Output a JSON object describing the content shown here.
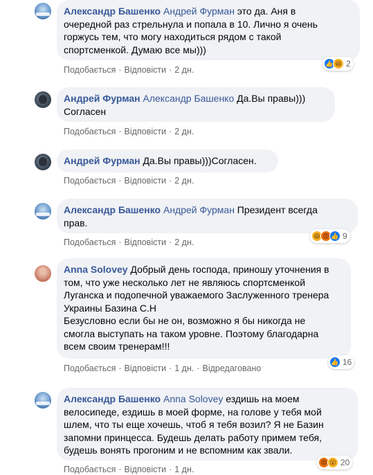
{
  "comments": [
    {
      "author": "Александр Башенко",
      "lines": [
        {
          "mention": "Андрей Фурман",
          "text": " это да. Аня в"
        },
        {
          "text": "очередной раз стрельнула и попала в 10. Лично я очень"
        },
        {
          "text": "горжусь тем, что могу находиться рядом с такой"
        },
        {
          "text": "спортсменкой. Думаю все мы)))"
        }
      ],
      "actions": {
        "like": "Подобається",
        "reply": "Відповісти",
        "time": "2 дн."
      },
      "reactions": {
        "icons": [
          "like-icon",
          "haha-icon"
        ],
        "count": "2"
      }
    },
    {
      "author": "Андрей Фурман",
      "lines": [
        {
          "mention": "Александр Башенко",
          "text": " Да.Вы правы)))"
        },
        {
          "text": "Согласен"
        }
      ],
      "actions": {
        "like": "Подобається",
        "reply": "Відповісти",
        "time": "2 дн."
      }
    },
    {
      "author": "Андрей Фурман",
      "lines": [
        {
          "text": " Да.Вы правы)))Согласен."
        }
      ],
      "actions": {
        "like": "Подобається",
        "reply": "Відповісти",
        "time": "2 дн."
      }
    },
    {
      "author": "Александр Башенко",
      "lines": [
        {
          "mention": "Андрей Фурман",
          "text": " Президент всегда"
        },
        {
          "text": "прав."
        }
      ],
      "actions": {
        "like": "Подобається",
        "reply": "Відповісти",
        "time": "2 дн."
      },
      "reactions": {
        "icons": [
          "haha-icon",
          "angry-icon",
          "like-icon"
        ],
        "count": "9"
      }
    },
    {
      "author": "Anna Solovey",
      "lines": [
        {
          "text": " Добрый день господа, приношу уточнения в"
        },
        {
          "text": "том, что уже несколько лет не являюсь спортсменкой"
        },
        {
          "text": "Луганска и подопечной уважаемого Заслуженного тренера"
        },
        {
          "text": "Украины Базина С.Н"
        },
        {
          "text": "Безусловно если бы не он, возможно я бы никогда не"
        },
        {
          "text": "смогла выступать на таком уровне. Поэтому благодарна"
        },
        {
          "text": "всем своим тренерам!!!"
        }
      ],
      "actions": {
        "like": "Подобається",
        "reply": "Відповісти",
        "time": "1 дн.",
        "edited": "Відредаговано"
      },
      "reactions": {
        "icons": [
          "like-icon"
        ],
        "count": "16"
      }
    },
    {
      "author": "Александр Башенко",
      "lines": [
        {
          "mention": "Anna Solovey",
          "text": " ездишь на моем"
        },
        {
          "text": "велосипеде, ездишь в моей форме, на голове у тебя мой"
        },
        {
          "text": "шлем, что ты еще хочешь, чтоб я тебя возил? Я не Базин"
        },
        {
          "text": "запомни принцесса. Будешь делать работу примем тебя,"
        },
        {
          "text": "будешь вонять прогоним и не вспомним как звали."
        }
      ],
      "actions": {
        "like": "Подобається",
        "reply": "Відповісти",
        "time": "1 дн."
      },
      "reactions": {
        "icons": [
          "angry-icon",
          "wow-icon"
        ],
        "count": "20"
      }
    }
  ],
  "colors": {
    "bubble_bg": "#f0f2f5",
    "author": "#385898",
    "meta": "#65676b",
    "like_blue": "#1877f2",
    "haha_yellow": "#f7b125",
    "angry_orange": "#e9710f"
  }
}
